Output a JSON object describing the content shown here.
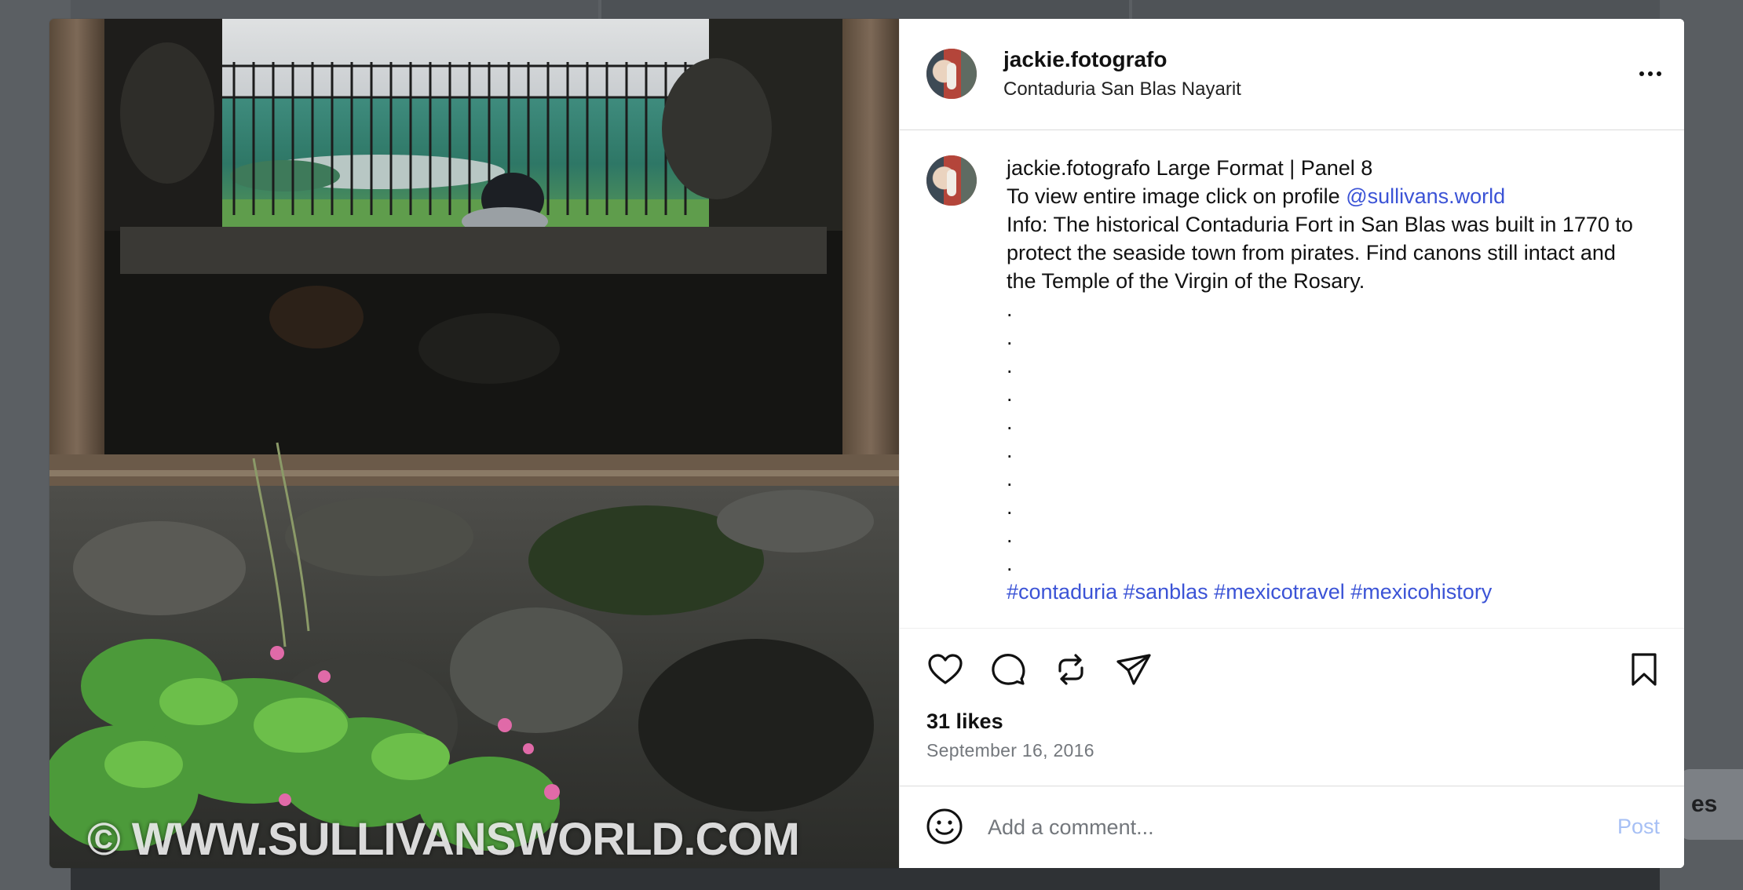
{
  "post": {
    "username": "jackie.fotografo",
    "location": "Contaduria San Blas Nayarit",
    "caption": {
      "username": "jackie.fotografo",
      "title": "Large Format | Panel 8",
      "line2_prefix": "To view entire image click on profile ",
      "mention": "@sullivans.world",
      "info": "Info: The historical Contaduria Fort in San Blas was built in 1770 to protect the seaside town from pirates. Find canons still intact and the Temple of the Virgin of the Rosary.",
      "dots": [
        ".",
        ".",
        ".",
        ".",
        ".",
        ".",
        ".",
        ".",
        ".",
        "."
      ],
      "hashtags": "#contaduria #sanblas #mexicotravel #mexicohistory"
    },
    "likes": "31 likes",
    "date": "September 16, 2016",
    "image_watermark": "© WWW.SULLIVANSWORLD.COM"
  },
  "comment": {
    "placeholder": "Add a comment...",
    "post_label": "Post"
  },
  "background": {
    "peek_text": "es"
  },
  "colors": {
    "link": "#3b53d6",
    "post_disabled": "#a7c0f5",
    "date": "#73777c"
  }
}
